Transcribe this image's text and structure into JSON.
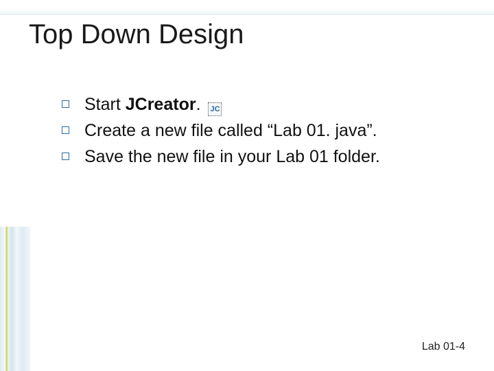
{
  "title": "Top Down Design",
  "bullets": [
    {
      "prefix": "Start ",
      "bold": "JCreator",
      "suffix": ". ",
      "icon": "JC"
    },
    {
      "text": "Create a new file called “Lab 01. java”."
    },
    {
      "text": "Save the new file in your Lab 01 folder."
    }
  ],
  "footer": "Lab 01-4"
}
